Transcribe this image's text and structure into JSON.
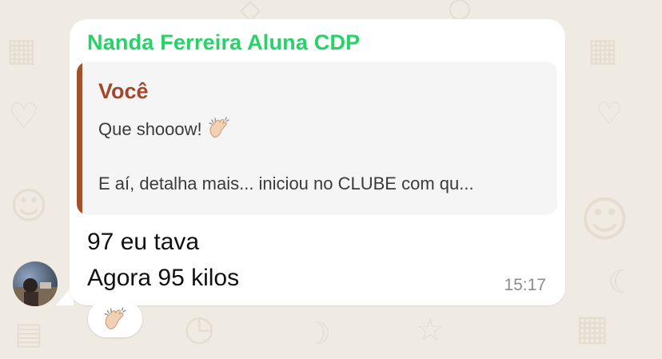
{
  "message": {
    "sender": "Nanda Ferreira Aluna CDP",
    "quoted": {
      "author": "Você",
      "line1": "Que shooow!",
      "line1_emoji": "clapping-hands",
      "line2": "E aí, detalha mais... iniciou no CLUBE com qu..."
    },
    "lines": [
      "97 eu tava",
      "Agora 95 kilos"
    ],
    "time": "15:17"
  },
  "reaction": {
    "emoji": "clapping-hands"
  },
  "colors": {
    "sender": "#25d366",
    "quote_author": "#a3472a",
    "quote_bar": "#a0522d",
    "bubble": "#ffffff",
    "background": "#efeae2"
  }
}
